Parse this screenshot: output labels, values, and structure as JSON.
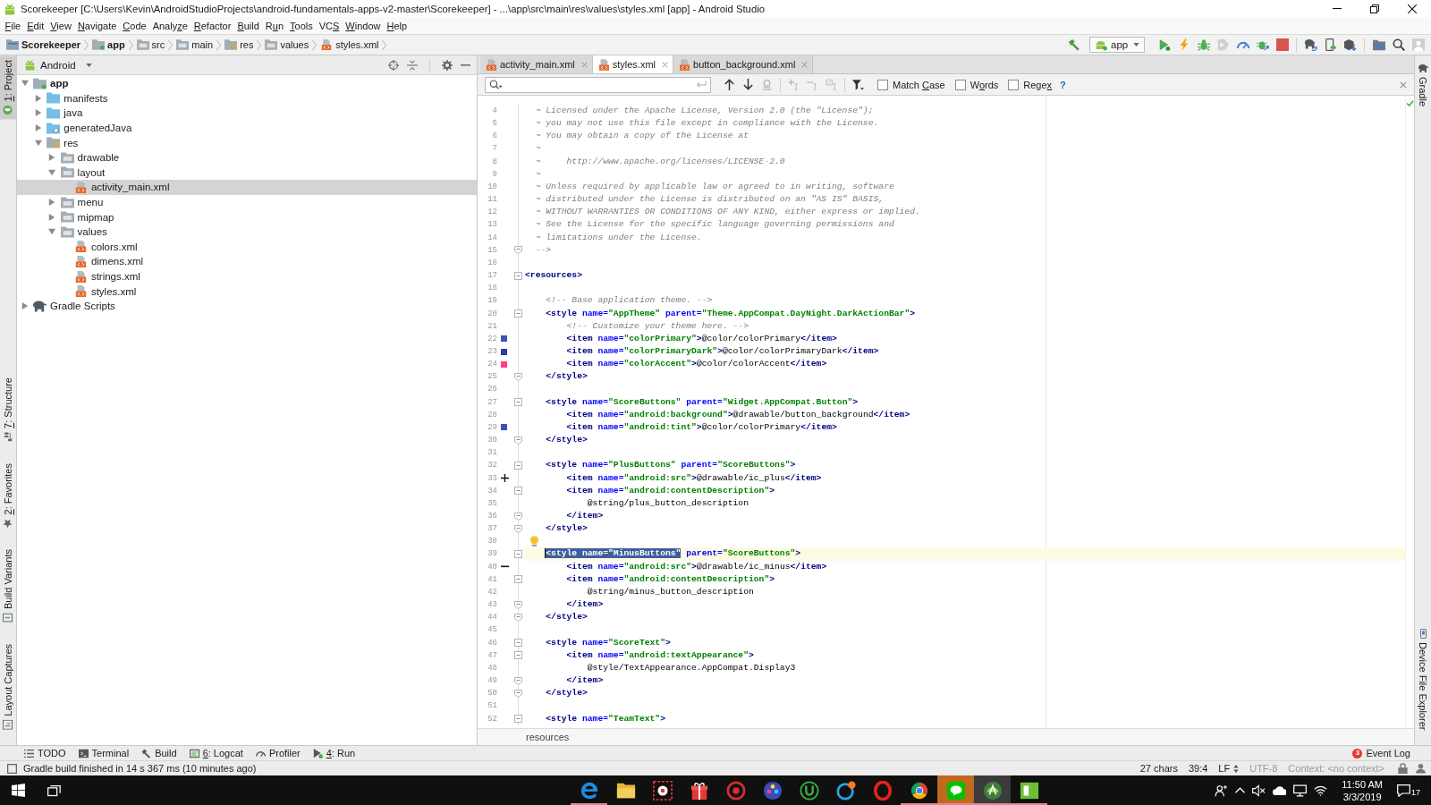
{
  "window": {
    "title": "Scorekeeper [C:\\Users\\Kevin\\AndroidStudioProjects\\android-fundamentals-apps-v2-master\\Scorekeeper] - ...\\app\\src\\main\\res\\values\\styles.xml [app] - Android Studio"
  },
  "menu": [
    {
      "mnemonic": "F",
      "post": "ile"
    },
    {
      "mnemonic": "E",
      "post": "dit"
    },
    {
      "mnemonic": "V",
      "post": "iew"
    },
    {
      "mnemonic": "N",
      "post": "avigate"
    },
    {
      "mnemonic": "C",
      "post": "ode"
    },
    {
      "pre": "Analy",
      "mnemonic": "z",
      "post": "e"
    },
    {
      "mnemonic": "R",
      "post": "efactor"
    },
    {
      "mnemonic": "B",
      "post": "uild"
    },
    {
      "pre": "R",
      "mnemonic": "u",
      "post": "n"
    },
    {
      "mnemonic": "T",
      "post": "ools"
    },
    {
      "pre": "VC",
      "mnemonic": "S"
    },
    {
      "mnemonic": "W",
      "post": "indow"
    },
    {
      "mnemonic": "H",
      "post": "elp"
    }
  ],
  "navigation_bar": {
    "breadcrumbs": [
      {
        "label": "Scorekeeper",
        "kind": "project"
      },
      {
        "label": "app",
        "kind": "module"
      },
      {
        "label": "src",
        "kind": "folder"
      },
      {
        "label": "main",
        "kind": "folder"
      },
      {
        "label": "res",
        "kind": "res-folder"
      },
      {
        "label": "values",
        "kind": "folder"
      },
      {
        "label": "styles.xml",
        "kind": "xml-file"
      }
    ],
    "toolbar": [
      {
        "kind": "hammer",
        "disabled": false
      },
      {
        "kind": "run-config",
        "label": "app",
        "disabled": false
      },
      {
        "kind": "play",
        "disabled": false
      },
      {
        "kind": "lightning",
        "disabled": false
      },
      {
        "kind": "bug",
        "disabled": false
      },
      {
        "kind": "shield-play",
        "disabled": true
      },
      {
        "kind": "gauge",
        "disabled": false
      },
      {
        "kind": "bug-arrow",
        "disabled": false
      },
      {
        "kind": "stop",
        "disabled": false
      },
      {
        "kind": "separator"
      },
      {
        "kind": "elephant-arrow",
        "disabled": false
      },
      {
        "kind": "phone",
        "disabled": false
      },
      {
        "kind": "box-arrow",
        "disabled": false
      },
      {
        "kind": "separator"
      },
      {
        "kind": "folder-grid",
        "disabled": false
      },
      {
        "kind": "search",
        "disabled": false
      },
      {
        "kind": "user",
        "disabled": false
      }
    ]
  },
  "left_tool_windows": {
    "top": [
      {
        "mnemonic": "1",
        "post": ": Project",
        "kind": "project",
        "selected": true
      }
    ],
    "bottom": [
      {
        "mnemonic": "7",
        "post": ": Structure",
        "kind": "structure",
        "selected": false
      },
      {
        "mnemonic": "2",
        "post": ": Favorites",
        "kind": "favorites",
        "selected": false
      },
      {
        "label": "Build Variants",
        "kind": "build-variants",
        "selected": false
      },
      {
        "label": "Layout Captures",
        "kind": "layout-captures",
        "selected": false
      }
    ]
  },
  "project": {
    "view": "Android",
    "tree": [
      {
        "label": "app",
        "kind": "module",
        "expanded": true,
        "selected": false,
        "children": [
          {
            "label": "manifests",
            "kind": "source-folder",
            "expanded": false,
            "selected": false
          },
          {
            "label": "java",
            "kind": "source-folder",
            "expanded": false,
            "selected": false
          },
          {
            "label": "generatedJava",
            "kind": "generated-folder",
            "expanded": false,
            "selected": false
          },
          {
            "label": "res",
            "kind": "res-folder",
            "expanded": true,
            "selected": false,
            "children": [
              {
                "label": "drawable",
                "kind": "res-subfolder",
                "expanded": false,
                "selected": false
              },
              {
                "label": "layout",
                "kind": "res-subfolder",
                "expanded": true,
                "selected": false,
                "children": [
                  {
                    "label": "activity_main.xml",
                    "kind": "xml-file",
                    "selected": true
                  }
                ]
              },
              {
                "label": "menu",
                "kind": "res-subfolder",
                "expanded": false,
                "selected": false
              },
              {
                "label": "mipmap",
                "kind": "res-subfolder",
                "expanded": false,
                "selected": false
              },
              {
                "label": "values",
                "kind": "res-subfolder",
                "expanded": true,
                "selected": false,
                "children": [
                  {
                    "label": "colors.xml",
                    "kind": "xml-file",
                    "selected": false
                  },
                  {
                    "label": "dimens.xml",
                    "kind": "xml-file",
                    "selected": false
                  },
                  {
                    "label": "strings.xml",
                    "kind": "xml-file",
                    "selected": false
                  },
                  {
                    "label": "styles.xml",
                    "kind": "xml-file",
                    "selected": false
                  }
                ]
              }
            ]
          }
        ]
      },
      {
        "label": "Gradle Scripts",
        "kind": "gradle",
        "expanded": false,
        "selected": false
      }
    ]
  },
  "editor": {
    "tabs": [
      {
        "label": "activity_main.xml",
        "selected": false
      },
      {
        "label": "styles.xml",
        "selected": true
      },
      {
        "label": "button_background.xml",
        "selected": false
      }
    ],
    "search": {
      "buttons": [
        {
          "kind": "arrow-up",
          "disabled": false
        },
        {
          "kind": "arrow-down",
          "disabled": false
        },
        {
          "kind": "find-all",
          "disabled": true
        },
        {
          "kind": "separator"
        },
        {
          "kind": "add-caret",
          "disabled": true
        },
        {
          "kind": "remove-caret",
          "disabled": true
        },
        {
          "kind": "select-carets",
          "disabled": true
        },
        {
          "kind": "separator"
        },
        {
          "kind": "filter",
          "disabled": false
        }
      ],
      "options": [
        {
          "pre": "Match ",
          "mnemonic": "C",
          "post": "ase",
          "checked": false
        },
        {
          "pre": "W",
          "mnemonic": "o",
          "post": "rds",
          "checked": false
        },
        {
          "pre": "Rege",
          "mnemonic": "x",
          "checked": false
        }
      ],
      "help": "?"
    },
    "lines": [
      {
        "number": "4",
        "current": false,
        "tokens": [
          {
            "kind": "comment",
            "text": "  ~ Licensed under the Apache License, Version 2.0 (the \"License\");"
          }
        ]
      },
      {
        "number": "5",
        "current": false,
        "tokens": [
          {
            "kind": "comment",
            "text": "  ~ you may not use this file except in compliance with the License."
          }
        ]
      },
      {
        "number": "6",
        "current": false,
        "tokens": [
          {
            "kind": "comment",
            "text": "  ~ You may obtain a copy of the License at"
          }
        ]
      },
      {
        "number": "7",
        "current": false,
        "tokens": [
          {
            "kind": "comment",
            "text": "  ~"
          }
        ]
      },
      {
        "number": "8",
        "current": false,
        "tokens": [
          {
            "kind": "comment",
            "text": "  ~     http://www.apache.org/licenses/LICENSE-2.0"
          }
        ]
      },
      {
        "number": "9",
        "current": false,
        "tokens": [
          {
            "kind": "comment",
            "text": "  ~"
          }
        ]
      },
      {
        "number": "10",
        "current": false,
        "tokens": [
          {
            "kind": "comment",
            "text": "  ~ Unless required by applicable law or agreed to in writing, software"
          }
        ]
      },
      {
        "number": "11",
        "current": false,
        "tokens": [
          {
            "kind": "comment",
            "text": "  ~ distributed under the License is distributed on an \"AS IS\" BASIS,"
          }
        ]
      },
      {
        "number": "12",
        "current": false,
        "tokens": [
          {
            "kind": "comment",
            "text": "  ~ WITHOUT WARRANTIES OR CONDITIONS OF ANY KIND, either express or implied."
          }
        ]
      },
      {
        "number": "13",
        "current": false,
        "tokens": [
          {
            "kind": "comment",
            "text": "  ~ See the License for the specific language governing permissions and"
          }
        ]
      },
      {
        "number": "14",
        "current": false,
        "tokens": [
          {
            "kind": "comment",
            "text": "  ~ limitations under the License."
          }
        ]
      },
      {
        "number": "15",
        "current": false,
        "fold": {
          "kind": "end"
        },
        "tokens": [
          {
            "kind": "comment",
            "text": "  -->"
          }
        ]
      },
      {
        "number": "16",
        "current": false
      },
      {
        "number": "17",
        "current": false,
        "fold": {
          "kind": "start"
        },
        "tokens": [
          {
            "kind": "tag",
            "text": "<resources>"
          }
        ]
      },
      {
        "number": "18",
        "current": false
      },
      {
        "number": "19",
        "current": false,
        "tokens": [
          {
            "kind": "comment",
            "text": "    <!-- Base application theme. -->"
          }
        ]
      },
      {
        "number": "20",
        "current": false,
        "fold": {
          "kind": "start"
        },
        "tokens": [
          {
            "kind": "tag",
            "text": "    <style"
          },
          {
            "kind": "attr",
            "text": " name="
          },
          {
            "kind": "value",
            "text": "\"AppTheme\""
          },
          {
            "kind": "attr",
            "text": " parent="
          },
          {
            "kind": "value",
            "text": "\"Theme.AppCompat.DayNight.DarkActionBar\""
          },
          {
            "kind": "tag",
            "text": ">"
          }
        ]
      },
      {
        "number": "21",
        "current": false,
        "tokens": [
          {
            "kind": "comment",
            "text": "        <!-- Customize your theme here. -->"
          }
        ]
      },
      {
        "number": "22",
        "current": false,
        "marker": {
          "kind": "swatch",
          "color": "#3f51b5"
        },
        "tokens": [
          {
            "kind": "tag",
            "text": "        <item"
          },
          {
            "kind": "attr",
            "text": " name="
          },
          {
            "kind": "value",
            "text": "\"colorPrimary\""
          },
          {
            "kind": "tag",
            "text": ">"
          },
          {
            "kind": "text",
            "text": "@color/colorPrimary"
          },
          {
            "kind": "tag",
            "text": "</item>"
          }
        ]
      },
      {
        "number": "23",
        "current": false,
        "marker": {
          "kind": "swatch",
          "color": "#303f9f"
        },
        "tokens": [
          {
            "kind": "tag",
            "text": "        <item"
          },
          {
            "kind": "attr",
            "text": " name="
          },
          {
            "kind": "value",
            "text": "\"colorPrimaryDark\""
          },
          {
            "kind": "tag",
            "text": ">"
          },
          {
            "kind": "text",
            "text": "@color/colorPrimaryDark"
          },
          {
            "kind": "tag",
            "text": "</item>"
          }
        ]
      },
      {
        "number": "24",
        "current": false,
        "marker": {
          "kind": "swatch",
          "color": "#ff4081"
        },
        "tokens": [
          {
            "kind": "tag",
            "text": "        <item"
          },
          {
            "kind": "attr",
            "text": " name="
          },
          {
            "kind": "value",
            "text": "\"colorAccent\""
          },
          {
            "kind": "tag",
            "text": ">"
          },
          {
            "kind": "text",
            "text": "@color/colorAccent"
          },
          {
            "kind": "tag",
            "text": "</item>"
          }
        ]
      },
      {
        "number": "25",
        "current": false,
        "fold": {
          "kind": "end"
        },
        "tokens": [
          {
            "kind": "tag",
            "text": "    </style>"
          }
        ]
      },
      {
        "number": "26",
        "current": false
      },
      {
        "number": "27",
        "current": false,
        "fold": {
          "kind": "start"
        },
        "tokens": [
          {
            "kind": "tag",
            "text": "    <style"
          },
          {
            "kind": "attr",
            "text": " name="
          },
          {
            "kind": "value",
            "text": "\"ScoreButtons\""
          },
          {
            "kind": "attr",
            "text": " parent="
          },
          {
            "kind": "value",
            "text": "\"Widget.AppCompat.Button\""
          },
          {
            "kind": "tag",
            "text": ">"
          }
        ]
      },
      {
        "number": "28",
        "current": false,
        "tokens": [
          {
            "kind": "tag",
            "text": "        <item"
          },
          {
            "kind": "attr",
            "text": " name="
          },
          {
            "kind": "value",
            "text": "\"android:background\""
          },
          {
            "kind": "tag",
            "text": ">"
          },
          {
            "kind": "text",
            "text": "@drawable/button_background"
          },
          {
            "kind": "tag",
            "text": "</item>"
          }
        ]
      },
      {
        "number": "29",
        "current": false,
        "marker": {
          "kind": "swatch",
          "color": "#3f51b5"
        },
        "tokens": [
          {
            "kind": "tag",
            "text": "        <item"
          },
          {
            "kind": "attr",
            "text": " name="
          },
          {
            "kind": "value",
            "text": "\"android:tint\""
          },
          {
            "kind": "tag",
            "text": ">"
          },
          {
            "kind": "text",
            "text": "@color/colorPrimary"
          },
          {
            "kind": "tag",
            "text": "</item>"
          }
        ]
      },
      {
        "number": "30",
        "current": false,
        "fold": {
          "kind": "end"
        },
        "tokens": [
          {
            "kind": "tag",
            "text": "    </style>"
          }
        ]
      },
      {
        "number": "31",
        "current": false
      },
      {
        "number": "32",
        "current": false,
        "fold": {
          "kind": "start"
        },
        "tokens": [
          {
            "kind": "tag",
            "text": "    <style"
          },
          {
            "kind": "attr",
            "text": " name="
          },
          {
            "kind": "value",
            "text": "\"PlusButtons\""
          },
          {
            "kind": "attr",
            "text": " parent="
          },
          {
            "kind": "value",
            "text": "\"ScoreButtons\""
          },
          {
            "kind": "tag",
            "text": ">"
          }
        ]
      },
      {
        "number": "33",
        "current": false,
        "marker": {
          "kind": "plus"
        },
        "tokens": [
          {
            "kind": "tag",
            "text": "        <item"
          },
          {
            "kind": "attr",
            "text": " name="
          },
          {
            "kind": "value",
            "text": "\"android:src\""
          },
          {
            "kind": "tag",
            "text": ">"
          },
          {
            "kind": "text",
            "text": "@drawable/ic_plus"
          },
          {
            "kind": "tag",
            "text": "</item>"
          }
        ]
      },
      {
        "number": "34",
        "current": false,
        "fold": {
          "kind": "start"
        },
        "tokens": [
          {
            "kind": "tag",
            "text": "        <item"
          },
          {
            "kind": "attr",
            "text": " name="
          },
          {
            "kind": "value",
            "text": "\"android:contentDescription\""
          },
          {
            "kind": "tag",
            "text": ">"
          }
        ]
      },
      {
        "number": "35",
        "current": false,
        "tokens": [
          {
            "kind": "text",
            "text": "            @string/plus_button_description"
          }
        ]
      },
      {
        "number": "36",
        "current": false,
        "fold": {
          "kind": "end"
        },
        "tokens": [
          {
            "kind": "tag",
            "text": "        </item>"
          }
        ]
      },
      {
        "number": "37",
        "current": false,
        "fold": {
          "kind": "end"
        },
        "tokens": [
          {
            "kind": "tag",
            "text": "    </style>"
          }
        ]
      },
      {
        "number": "38",
        "current": false,
        "marker": {
          "kind": "bulb"
        }
      },
      {
        "number": "39",
        "current": true,
        "fold": {
          "kind": "start"
        },
        "tokens": [
          {
            "kind": "selection",
            "text": "<style name=\"MinusButtons\""
          },
          {
            "kind": "attr",
            "text": " parent="
          },
          {
            "kind": "value",
            "text": "\"ScoreButtons\""
          },
          {
            "kind": "tag",
            "text": ">"
          }
        ]
      },
      {
        "number": "40",
        "current": false,
        "marker": {
          "kind": "minus"
        },
        "tokens": [
          {
            "kind": "tag",
            "text": "        <item"
          },
          {
            "kind": "attr",
            "text": " name="
          },
          {
            "kind": "value",
            "text": "\"android:src\""
          },
          {
            "kind": "tag",
            "text": ">"
          },
          {
            "kind": "text",
            "text": "@drawable/ic_minus"
          },
          {
            "kind": "tag",
            "text": "</item>"
          }
        ]
      },
      {
        "number": "41",
        "current": false,
        "fold": {
          "kind": "start"
        },
        "tokens": [
          {
            "kind": "tag",
            "text": "        <item"
          },
          {
            "kind": "attr",
            "text": " name="
          },
          {
            "kind": "value",
            "text": "\"android:contentDescription\""
          },
          {
            "kind": "tag",
            "text": ">"
          }
        ]
      },
      {
        "number": "42",
        "current": false,
        "tokens": [
          {
            "kind": "text",
            "text": "            @string/minus_button_description"
          }
        ]
      },
      {
        "number": "43",
        "current": false,
        "fold": {
          "kind": "end"
        },
        "tokens": [
          {
            "kind": "tag",
            "text": "        </item>"
          }
        ]
      },
      {
        "number": "44",
        "current": false,
        "fold": {
          "kind": "end"
        },
        "tokens": [
          {
            "kind": "tag",
            "text": "    </style>"
          }
        ]
      },
      {
        "number": "45",
        "current": false
      },
      {
        "number": "46",
        "current": false,
        "fold": {
          "kind": "start"
        },
        "tokens": [
          {
            "kind": "tag",
            "text": "    <style"
          },
          {
            "kind": "attr",
            "text": " name="
          },
          {
            "kind": "value",
            "text": "\"ScoreText\""
          },
          {
            "kind": "tag",
            "text": ">"
          }
        ]
      },
      {
        "number": "47",
        "current": false,
        "fold": {
          "kind": "start"
        },
        "tokens": [
          {
            "kind": "tag",
            "text": "        <item"
          },
          {
            "kind": "attr",
            "text": " name="
          },
          {
            "kind": "value",
            "text": "\"android:textAppearance\""
          },
          {
            "kind": "tag",
            "text": ">"
          }
        ]
      },
      {
        "number": "48",
        "current": false,
        "tokens": [
          {
            "kind": "text",
            "text": "            @style/TextAppearance.AppCompat.Display3"
          }
        ]
      },
      {
        "number": "49",
        "current": false,
        "fold": {
          "kind": "end"
        },
        "tokens": [
          {
            "kind": "tag",
            "text": "        </item>"
          }
        ]
      },
      {
        "number": "50",
        "current": false,
        "fold": {
          "kind": "end"
        },
        "tokens": [
          {
            "kind": "tag",
            "text": "    </style>"
          }
        ]
      },
      {
        "number": "51",
        "current": false
      },
      {
        "number": "52",
        "current": false,
        "fold": {
          "kind": "start"
        },
        "tokens": [
          {
            "kind": "tag",
            "text": "    <style"
          },
          {
            "kind": "attr",
            "text": " name="
          },
          {
            "kind": "value",
            "text": "\"TeamText\""
          },
          {
            "kind": "tag",
            "text": ">"
          }
        ]
      }
    ],
    "breadcrumb": "resources"
  },
  "right_tool_windows": {
    "top": [
      {
        "label": "Gradle",
        "kind": "gradle",
        "selected": false
      }
    ],
    "bottom": [
      {
        "label": "Device File Explorer",
        "kind": "device",
        "selected": false
      }
    ]
  },
  "bottom_tool_windows": [
    {
      "label": "TODO",
      "kind": "todo",
      "selected": false
    },
    {
      "label": "Terminal",
      "kind": "terminal",
      "selected": false
    },
    {
      "label": "Build",
      "kind": "build",
      "selected": false
    },
    {
      "mnemonic": "6",
      "post": ": Logcat",
      "kind": "logcat",
      "selected": false
    },
    {
      "label": "Profiler",
      "kind": "profiler",
      "selected": false
    },
    {
      "mnemonic": "4",
      "post": ": Run",
      "kind": "run",
      "selected": false
    }
  ],
  "event_log": {
    "label": "Event Log",
    "badge": "3"
  },
  "status_bar": {
    "message": "Gradle build finished in 14 s 367 ms (10 minutes ago)",
    "items": [
      {
        "text": "27 chars",
        "disabled": false,
        "dropdown": false
      },
      {
        "text": "39:4",
        "disabled": false,
        "dropdown": false
      },
      {
        "text": "LF",
        "disabled": false,
        "dropdown": true
      },
      {
        "text": "UTF-8",
        "disabled": true,
        "dropdown": false
      },
      {
        "text": "Context: <no context>",
        "disabled": true,
        "dropdown": false
      }
    ]
  },
  "taskbar": {
    "apps": [
      {
        "kind": "e-swirl",
        "running": true,
        "active": false,
        "attention": false
      },
      {
        "kind": "folder",
        "running": false,
        "active": false,
        "attention": false
      },
      {
        "kind": "gear-square",
        "running": false,
        "active": false,
        "attention": false
      },
      {
        "kind": "gift",
        "running": false,
        "active": false,
        "attention": false
      },
      {
        "kind": "ring",
        "running": false,
        "active": false,
        "attention": false
      },
      {
        "kind": "dots",
        "running": false,
        "active": false,
        "attention": false
      },
      {
        "kind": "u-circle",
        "running": false,
        "active": false,
        "attention": false
      },
      {
        "kind": "refresh-circle",
        "running": false,
        "active": false,
        "attention": false
      },
      {
        "kind": "o-ring",
        "running": false,
        "active": false,
        "attention": false
      },
      {
        "kind": "pinwheel",
        "running": true,
        "active": false,
        "attention": false
      },
      {
        "kind": "speech-bubble",
        "running": true,
        "active": false,
        "attention": true
      },
      {
        "kind": "android",
        "running": true,
        "active": true,
        "attention": false
      },
      {
        "kind": "window",
        "running": true,
        "active": false,
        "attention": false
      }
    ],
    "clock": {
      "time": "11:50 AM",
      "date": "3/3/2019"
    },
    "notification_count": "17"
  }
}
